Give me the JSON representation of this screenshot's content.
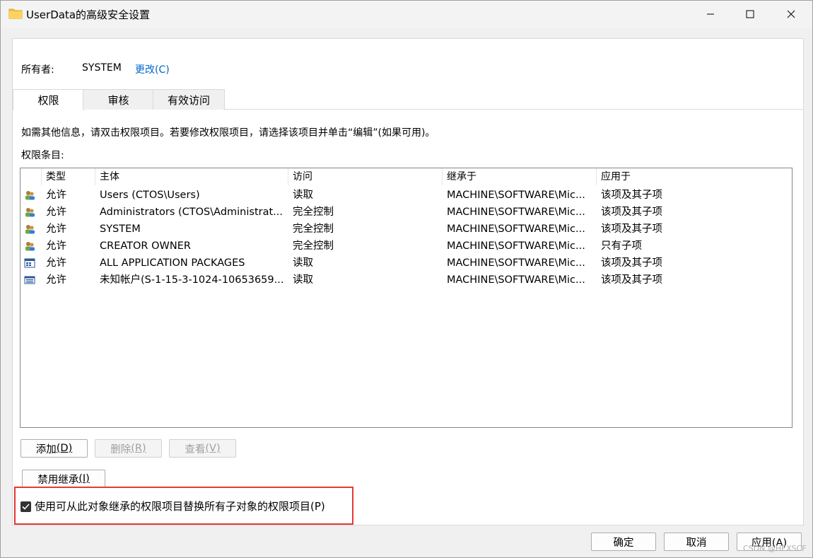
{
  "window": {
    "title": "UserData的高级安全设置"
  },
  "owner": {
    "label": "所有者:",
    "value": "SYSTEM",
    "change_link": "更改(C)"
  },
  "tabs": [
    {
      "label": "权限"
    },
    {
      "label": "审核"
    },
    {
      "label": "有效访问"
    }
  ],
  "info_text": "如需其他信息，请双击权限项目。若要修改权限项目，请选择该项目并单击“编辑”(如果可用)。",
  "list_label": "权限条目:",
  "columns": [
    "类型",
    "主体",
    "访问",
    "继承于",
    "应用于"
  ],
  "rows": [
    {
      "icon": "users-icon",
      "type": "允许",
      "principal": "Users (CTOS\\Users)",
      "access": "读取",
      "inherited": "MACHINE\\SOFTWARE\\Mic...",
      "applies": "该项及其子项"
    },
    {
      "icon": "users-icon",
      "type": "允许",
      "principal": "Administrators (CTOS\\Administrat...",
      "access": "完全控制",
      "inherited": "MACHINE\\SOFTWARE\\Mic...",
      "applies": "该项及其子项"
    },
    {
      "icon": "users-icon",
      "type": "允许",
      "principal": "SYSTEM",
      "access": "完全控制",
      "inherited": "MACHINE\\SOFTWARE\\Mic...",
      "applies": "该项及其子项"
    },
    {
      "icon": "users-icon",
      "type": "允许",
      "principal": "CREATOR OWNER",
      "access": "完全控制",
      "inherited": "MACHINE\\SOFTWARE\\Mic...",
      "applies": "只有子项"
    },
    {
      "icon": "app-packages-icon",
      "type": "允许",
      "principal": "ALL APPLICATION PACKAGES",
      "access": "读取",
      "inherited": "MACHINE\\SOFTWARE\\Mic...",
      "applies": "该项及其子项"
    },
    {
      "icon": "unknown-account-icon",
      "type": "允许",
      "principal": "未知帐户(S-1-15-3-1024-10653659...",
      "access": "读取",
      "inherited": "MACHINE\\SOFTWARE\\Mic...",
      "applies": "该项及其子项"
    }
  ],
  "buttons": {
    "add": "添加",
    "add_key": "(D)",
    "remove": "删除",
    "remove_key": "(R)",
    "view": "查看",
    "view_key": "(V)",
    "disable_inherit": "禁用继承",
    "disable_inherit_key": "(I)",
    "ok": "确定",
    "cancel": "取消",
    "apply": "应用(A)"
  },
  "checkbox": {
    "label": "使用可从此对象继承的权限项目替换所有子对象的权限项目(P)",
    "checked": true
  },
  "watermark": "CSDN @HEXSCF"
}
